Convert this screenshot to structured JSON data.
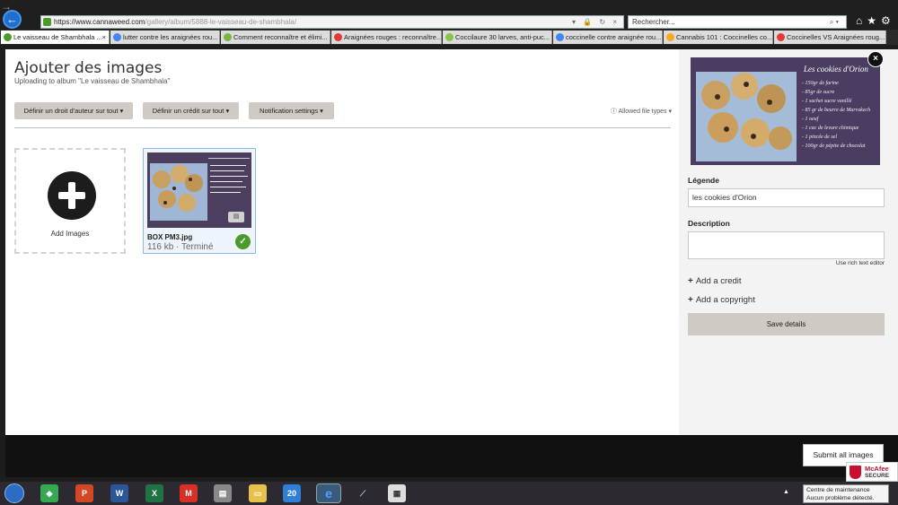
{
  "browser": {
    "url_host": "https://www.cannaweed.com",
    "url_path": "/gallery/album/5888-le-vaisseau-de-shambhala/",
    "search_placeholder": "Rechercher...",
    "tabs": [
      {
        "label": "Le vaisseau de Shambhala ...",
        "color": "#4c9a2a",
        "active": true
      },
      {
        "label": "lutter contre les araignées rou...",
        "color": "#4285f4"
      },
      {
        "label": "Comment reconnaître et élimi...",
        "color": "#7cb342"
      },
      {
        "label": "Araignées rouges : reconnaître...",
        "color": "#e53935"
      },
      {
        "label": "Coccilaure 30 larves, anti-puc...",
        "color": "#8bc34a"
      },
      {
        "label": "coccinelle contre araignée rou...",
        "color": "#4285f4"
      },
      {
        "label": "Cannabis 101 : Coccinelles co...",
        "color": "#f9a825"
      },
      {
        "label": "Coccinelles VS Araignées roug...",
        "color": "#e53935"
      }
    ]
  },
  "page": {
    "title": "Ajouter des images",
    "subtitle": "Uploading to album \"Le vaisseau de Shambhala\"",
    "toolbar": {
      "copyright_btn": "Définir un droit d'auteur sur tout ▾",
      "credit_btn": "Définir un crédit sur tout ▾",
      "notification_btn": "Notification settings ▾",
      "allowed_types": "ⓘ Allowed file types ▾"
    },
    "add_images_label": "Add Images",
    "file": {
      "name": "BOX PM3.jpg",
      "meta": "116 kb · Terminé"
    }
  },
  "image_text": {
    "title": "Les cookies d'Orion",
    "recipe": [
      "- 150gr de farine",
      "- 85gr de sucre",
      "- 1 sachet sucre vanillé",
      "- 85 gr de beurre de Marrakech",
      "- 1 oeuf",
      "- 1 cac de levure chimique",
      "- 1 pincée de sel",
      "- 100gr de pépite de chocolat"
    ]
  },
  "sidebar": {
    "legend_label": "Légende",
    "legend_value": "les cookies d'Orion",
    "description_label": "Description",
    "description_value": "",
    "rich_text": "Use rich text editor",
    "add_credit": "Add a credit",
    "add_copyright": "Add a copyright",
    "save": "Save details"
  },
  "footer": {
    "submit": "Submit all images",
    "mcafee_brand": "McAfee",
    "mcafee_secure": "SECURE"
  },
  "taskbar": {
    "calendar_day": "20",
    "tooltip_line1": "Centre de maintenance",
    "tooltip_line2": "Aucun problème détecté."
  }
}
